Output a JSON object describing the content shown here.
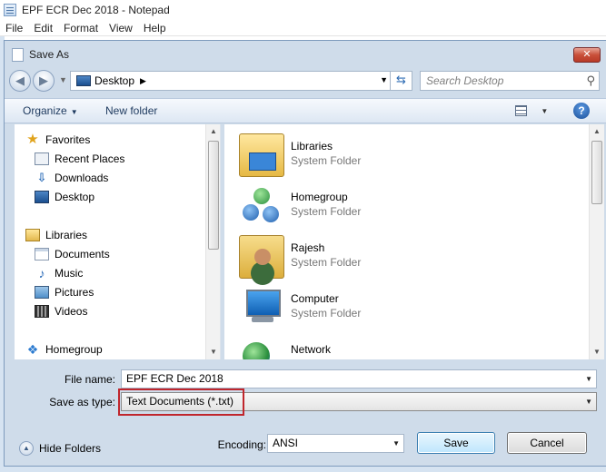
{
  "notepad": {
    "title": "EPF ECR Dec 2018 - Notepad",
    "menu": [
      "File",
      "Edit",
      "Format",
      "View",
      "Help"
    ]
  },
  "dialog": {
    "title": "Save As",
    "close_label": "✕",
    "address": {
      "location": "Desktop",
      "search_placeholder": "Search Desktop"
    },
    "toolbar": {
      "organize": "Organize",
      "new_folder": "New folder",
      "help": "?"
    },
    "nav_pane": {
      "favorites": {
        "label": "Favorites",
        "items": [
          {
            "label": "Recent Places",
            "icon": "recent-places-icon"
          },
          {
            "label": "Downloads",
            "icon": "downloads-icon"
          },
          {
            "label": "Desktop",
            "icon": "desktop-icon"
          }
        ]
      },
      "libraries": {
        "label": "Libraries",
        "items": [
          {
            "label": "Documents",
            "icon": "documents-icon"
          },
          {
            "label": "Music",
            "icon": "music-icon"
          },
          {
            "label": "Pictures",
            "icon": "pictures-icon"
          },
          {
            "label": "Videos",
            "icon": "videos-icon"
          }
        ]
      },
      "homegroup": {
        "label": "Homegroup"
      }
    },
    "files": [
      {
        "name": "Libraries",
        "type": "System Folder",
        "icon": "libraries-folder-icon"
      },
      {
        "name": "Homegroup",
        "type": "System Folder",
        "icon": "homegroup-icon"
      },
      {
        "name": "Rajesh",
        "type": "System Folder",
        "icon": "user-folder-icon"
      },
      {
        "name": "Computer",
        "type": "System Folder",
        "icon": "computer-icon"
      },
      {
        "name": "Network",
        "type": "",
        "icon": "network-icon"
      }
    ],
    "form": {
      "file_name_label": "File name:",
      "file_name_value": "EPF ECR Dec 2018",
      "save_type_label": "Save as type:",
      "save_type_value": "Text Documents (*.txt)",
      "encoding_label": "Encoding:",
      "encoding_value": "ANSI",
      "hide_folders": "Hide Folders",
      "save_button": "Save",
      "cancel_button": "Cancel"
    },
    "highlight_color": "#c0262d"
  }
}
